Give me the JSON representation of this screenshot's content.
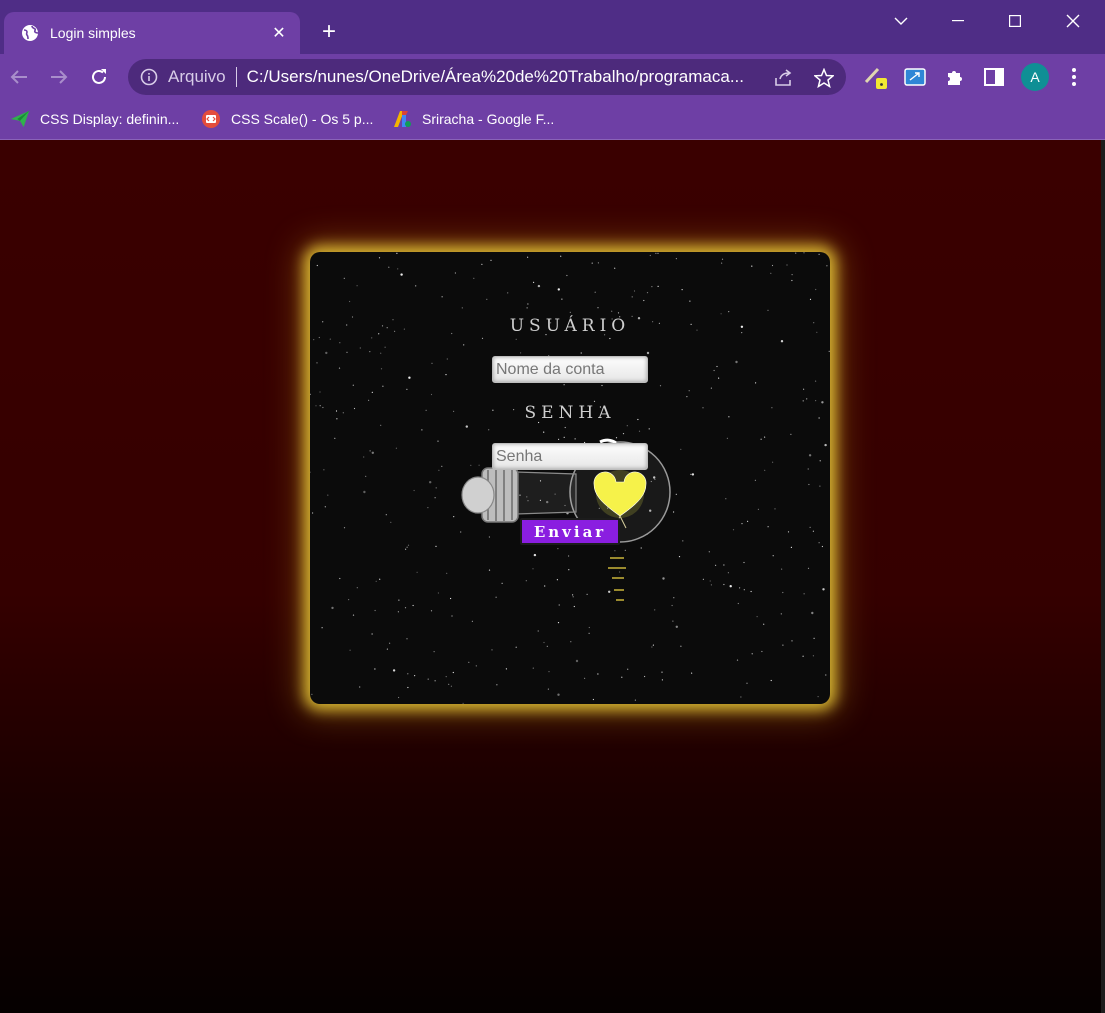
{
  "browser": {
    "tab": {
      "title": "Login simples",
      "close": "✕",
      "icon": "globe-icon"
    },
    "new_tab": "+",
    "omnibox": {
      "security_chip": "Arquivo",
      "url": "C:/Users/nunes/OneDrive/Área%20de%20Trabalho/programaca..."
    },
    "profile_initial": "A",
    "bookmarks": [
      {
        "label": "CSS Display: definin...",
        "icon": "paper-plane-icon"
      },
      {
        "label": "CSS Scale() - Os 5 p...",
        "icon": "code-badge-icon"
      },
      {
        "label": "Sriracha - Google F...",
        "icon": "google-fonts-icon"
      }
    ]
  },
  "login": {
    "user_label": "USUÁRIO",
    "user_placeholder": "Nome da conta",
    "password_label": "SENHA",
    "password_placeholder": "Senha",
    "submit_label": "Enviar"
  },
  "colors": {
    "chrome_dark": "#4f2d86",
    "chrome": "#6e3fa5",
    "page_bg": "#3a0000",
    "card_glow": "#eccd3a",
    "button": "#8a1ee0",
    "heart": "#f6f24a"
  }
}
